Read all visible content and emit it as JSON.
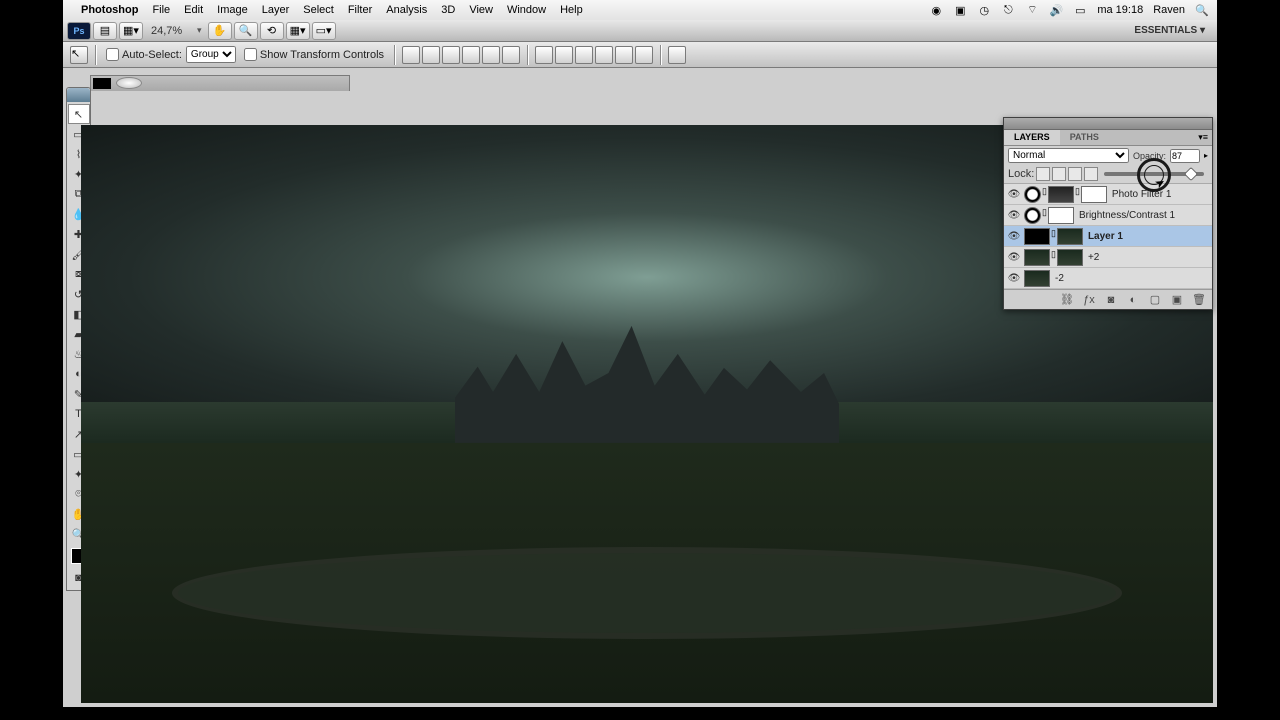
{
  "menubar": {
    "app_name": "Photoshop",
    "items": [
      "File",
      "Edit",
      "Image",
      "Layer",
      "Select",
      "Filter",
      "Analysis",
      "3D",
      "View",
      "Window",
      "Help"
    ],
    "clock": "ma 19:18",
    "user": "Raven"
  },
  "toolbar": {
    "zoom": "24,7%",
    "essentials": "ESSENTIALS ▾"
  },
  "options": {
    "auto_select_label": "Auto-Select:",
    "auto_select_value": "Group",
    "transform_label": "Show Transform Controls"
  },
  "layers_panel": {
    "tab_layers": "LAYERS",
    "tab_paths": "PATHS",
    "blend_mode": "Normal",
    "opacity_label": "Opacity:",
    "opacity_value": "87",
    "lock_label": "Lock:",
    "slider_pos": "82%",
    "layers": [
      {
        "name": "Photo Filter 1",
        "kind": "adjustment",
        "mask": "white"
      },
      {
        "name": "Brightness/Contrast 1",
        "kind": "adjustment",
        "mask": "white"
      },
      {
        "name": "Layer 1",
        "kind": "pixel",
        "mask": "mask",
        "selected": true
      },
      {
        "name": "+2",
        "kind": "pixel",
        "mask": "mask"
      },
      {
        "name": "-2",
        "kind": "pixel"
      }
    ]
  }
}
